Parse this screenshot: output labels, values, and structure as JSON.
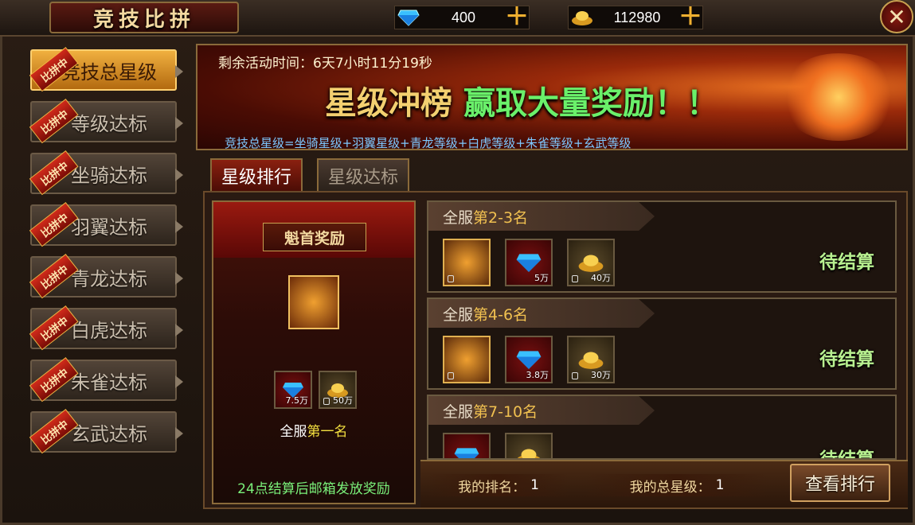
{
  "header": {
    "title": "竞技比拼",
    "diamonds": "400",
    "gold": "112980",
    "plus_icon": "plus-icon",
    "close_icon": "close-icon"
  },
  "sidebar": {
    "badge": "比拼中",
    "items": [
      {
        "label": "竞技总星级",
        "active": true
      },
      {
        "label": "等级达标",
        "active": false
      },
      {
        "label": "坐骑达标",
        "active": false
      },
      {
        "label": "羽翼达标",
        "active": false
      },
      {
        "label": "青龙达标",
        "active": false
      },
      {
        "label": "白虎达标",
        "active": false
      },
      {
        "label": "朱雀达标",
        "active": false
      },
      {
        "label": "玄武达标",
        "active": false
      }
    ]
  },
  "banner": {
    "time_label": "剩余活动时间：",
    "time_value": "6天7小时11分19秒",
    "slogan_a": "星级冲榜",
    "slogan_b": "赢取大量奖励！！",
    "desc": "竞技总星级=坐骑星级+羽翼星级+青龙等级+白虎等级+朱雀等级+玄武等级"
  },
  "tabs": [
    {
      "label": "星级排行",
      "active": true
    },
    {
      "label": "星级达标",
      "active": false
    }
  ],
  "champion": {
    "title": "魁首奖励",
    "diamond_qty": "7.5万",
    "gold_qty": "50万",
    "rank_prefix": "全服",
    "rank_highlight": "第一名",
    "note": "24点结算后邮箱发放奖励"
  },
  "ranks": [
    {
      "prefix": "全服",
      "range": "第2-3名",
      "diamond_qty": "5万",
      "gold_qty": "40万",
      "status": "待结算"
    },
    {
      "prefix": "全服",
      "range": "第4-6名",
      "diamond_qty": "3.8万",
      "gold_qty": "30万",
      "status": "待结算"
    },
    {
      "prefix": "全服",
      "range": "第7-10名",
      "diamond_qty": "",
      "gold_qty": "",
      "status": "待结算"
    }
  ],
  "footer": {
    "my_rank_label": "我的排名：",
    "my_rank_value": "1",
    "my_stars_label": "我的总星级：",
    "my_stars_value": "1",
    "view_button": "查看排行"
  },
  "colors": {
    "accent_gold": "#f0c050",
    "slogan_green": "#6af06a",
    "status_green": "#b8f090",
    "desc_blue": "#7ec8ff"
  }
}
